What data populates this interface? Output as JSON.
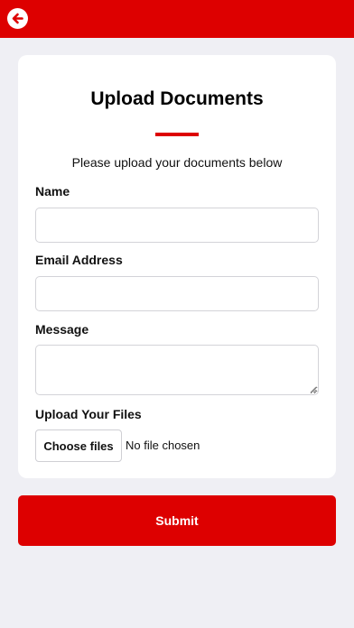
{
  "header": {
    "back_icon": "arrow-left-circle-icon",
    "accent_color": "#dd0000"
  },
  "form": {
    "title": "Upload Documents",
    "subtitle": "Please upload your documents below",
    "name_label": "Name",
    "name_value": "",
    "email_label": "Email Address",
    "email_value": "",
    "message_label": "Message",
    "message_value": "",
    "files_label": "Upload Your Files",
    "choose_files_label": "Choose files",
    "file_status": "No file chosen",
    "submit_label": "Submit"
  }
}
